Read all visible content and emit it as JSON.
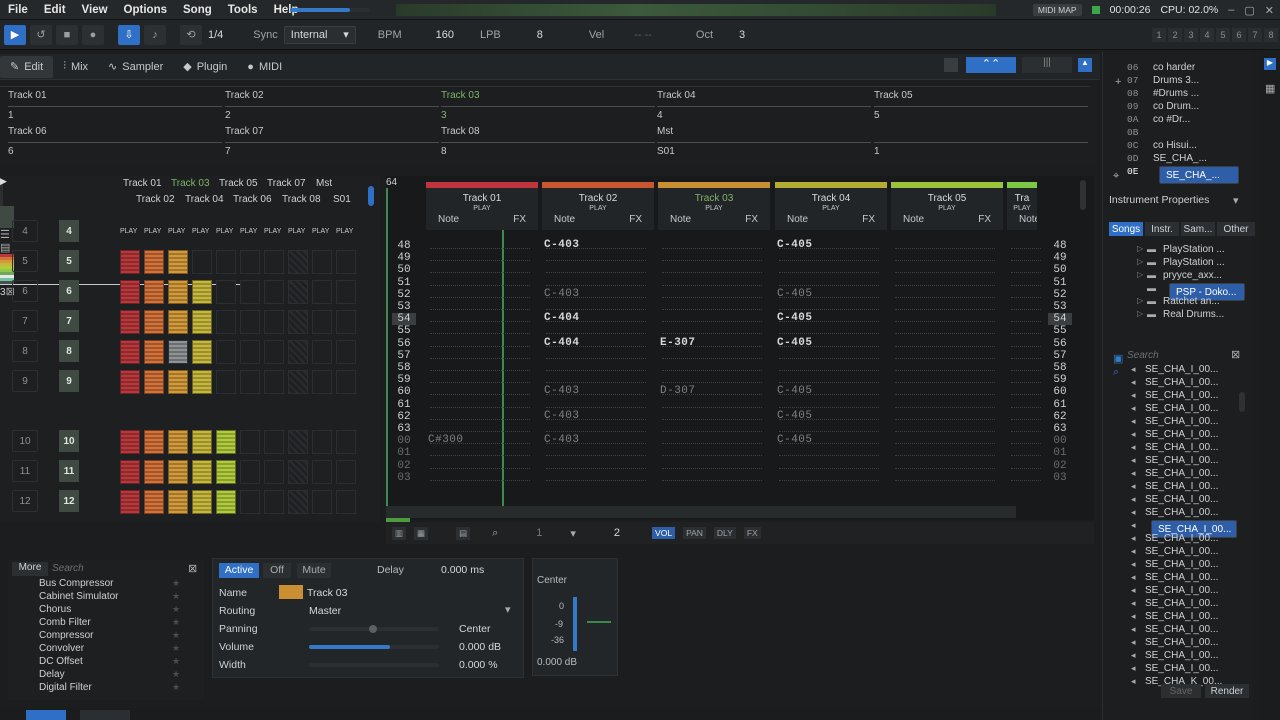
{
  "menu": [
    "File",
    "Edit",
    "View",
    "Options",
    "Song",
    "Tools",
    "Help"
  ],
  "status": {
    "midi_map": "MIDI MAP",
    "time": "00:00:26",
    "cpu": "CPU: 02.0%"
  },
  "transport": {
    "pattern_pos": "1/4",
    "sync_label": "Sync",
    "sync_value": "Internal",
    "bpm_label": "BPM",
    "bpm": "160",
    "lpb_label": "LPB",
    "lpb": "8",
    "vel_label": "Vel",
    "vel_value": "-- --",
    "oct_label": "Oct",
    "oct": "3",
    "oct_buttons": [
      "1",
      "2",
      "3",
      "4",
      "5",
      "6",
      "7",
      "8"
    ]
  },
  "tabs": [
    "Edit",
    "Mix",
    "Sampler",
    "Plugin",
    "MIDI"
  ],
  "scopes": [
    {
      "name": "Track 01",
      "num": "1",
      "active": false
    },
    {
      "name": "Track 02",
      "num": "2",
      "active": false
    },
    {
      "name": "Track 03",
      "num": "3",
      "active": true
    },
    {
      "name": "Track 04",
      "num": "4",
      "active": false
    },
    {
      "name": "Track 05",
      "num": "5",
      "active": false
    },
    {
      "name": "Track 06",
      "num": "6",
      "active": false
    },
    {
      "name": "Track 07",
      "num": "7",
      "active": false
    },
    {
      "name": "Track 08",
      "num": "8",
      "active": false
    },
    {
      "name": "Mst",
      "num": "S01",
      "active": false
    },
    {
      "name": "",
      "num": "1",
      "active": false
    }
  ],
  "matrix": {
    "header_top": [
      "Track 01",
      "Track 03",
      "Track 05",
      "Track 07",
      "Mst"
    ],
    "header_bottom": [
      "Track 02",
      "Track 04",
      "Track 06",
      "Track 08",
      "S01"
    ],
    "play": "PLAY",
    "seq_left": [
      "4",
      "5",
      "6",
      "7",
      "8",
      "9",
      "10",
      "11",
      "12"
    ],
    "seq_right": [
      "4",
      "5",
      "6",
      "7",
      "8",
      "9",
      "10",
      "11",
      "12"
    ],
    "block_label": "3"
  },
  "pattern": {
    "lines": "64",
    "tracks": [
      {
        "name": "Track 01",
        "color": "#c0353d",
        "active": false
      },
      {
        "name": "Track 02",
        "color": "#c9562f",
        "active": false
      },
      {
        "name": "Track 03",
        "color": "#c98f32",
        "active": true
      },
      {
        "name": "Track 04",
        "color": "#b4ad33",
        "active": false
      },
      {
        "name": "Track 05",
        "color": "#9dc33a",
        "active": false
      },
      {
        "name": "Tra",
        "color": "#7dc842",
        "active": false
      }
    ],
    "play": "PLAY",
    "note": "Note",
    "fx": "FX",
    "rows": [
      "48",
      "49",
      "50",
      "51",
      "52",
      "53",
      "54",
      "55",
      "56",
      "57",
      "58",
      "59",
      "60",
      "61",
      "62",
      "63",
      "00",
      "01",
      "02",
      "03"
    ],
    "notes": [
      {
        "row": 0,
        "col": 1,
        "v": "C-403",
        "dim": false
      },
      {
        "row": 0,
        "col": 3,
        "v": "C-405",
        "dim": false
      },
      {
        "row": 4,
        "col": 1,
        "v": "C-403",
        "dim": true
      },
      {
        "row": 4,
        "col": 3,
        "v": "C-405",
        "dim": true
      },
      {
        "row": 6,
        "col": 1,
        "v": "C-404",
        "dim": false
      },
      {
        "row": 6,
        "col": 3,
        "v": "C-405",
        "dim": false
      },
      {
        "row": 8,
        "col": 1,
        "v": "C-404",
        "dim": false
      },
      {
        "row": 8,
        "col": 2,
        "v": "E-307",
        "dim": false
      },
      {
        "row": 8,
        "col": 3,
        "v": "C-405",
        "dim": false
      },
      {
        "row": 12,
        "col": 1,
        "v": "C-403",
        "dim": true
      },
      {
        "row": 12,
        "col": 2,
        "v": "D-307",
        "dim": true
      },
      {
        "row": 12,
        "col": 3,
        "v": "C-405",
        "dim": true
      },
      {
        "row": 14,
        "col": 1,
        "v": "C-403",
        "dim": true
      },
      {
        "row": 14,
        "col": 3,
        "v": "C-405",
        "dim": true
      },
      {
        "row": 16,
        "col": 0,
        "v": "C#300",
        "dim": true
      },
      {
        "row": 16,
        "col": 1,
        "v": "C-403",
        "dim": true
      },
      {
        "row": 16,
        "col": 3,
        "v": "C-405",
        "dim": true
      }
    ]
  },
  "pattern_bar": {
    "v1": "1",
    "v2": "2",
    "toggles": [
      "VOL",
      "PAN",
      "DLY",
      "FX"
    ]
  },
  "dsp": {
    "more": "More",
    "search": "Search",
    "items": [
      "Bus Compressor",
      "Cabinet Simulator",
      "Chorus",
      "Comb Filter",
      "Compressor",
      "Convolver",
      "DC Offset",
      "Delay",
      "Digital Filter"
    ]
  },
  "device": {
    "active": "Active",
    "off": "Off",
    "mute": "Mute",
    "delay_label": "Delay",
    "delay_value": "0.000 ms",
    "name_label": "Name",
    "name_value": "Track 03",
    "routing_label": "Routing",
    "routing_value": "Master",
    "panning_label": "Panning",
    "panning_value": "Center",
    "volume_label": "Volume",
    "volume_value": "0.000 dB",
    "width_label": "Width",
    "width_value": "0.000 %",
    "volume_level": 0.62,
    "panning_level": 0.5,
    "width_level": 0.02
  },
  "meter": {
    "label": "Center",
    "marks": [
      "0",
      "-9",
      "-36"
    ],
    "value": "0.000 dB"
  },
  "instruments": {
    "list": [
      {
        "n": "06",
        "name": "co harder"
      },
      {
        "n": "07",
        "name": "Drums 3..."
      },
      {
        "n": "08",
        "name": "#Drums ..."
      },
      {
        "n": "09",
        "name": "co Drum..."
      },
      {
        "n": "0A",
        "name": "co #Dr..."
      },
      {
        "n": "0B",
        "name": ""
      },
      {
        "n": "0C",
        "name": "co Hisui..."
      },
      {
        "n": "0D",
        "name": "SE_CHA_..."
      },
      {
        "n": "0E",
        "name": "SE_CHA_..."
      }
    ],
    "title": "Instrument Properties",
    "tabs": [
      "Songs",
      "Instr.",
      "Sam...",
      "Other"
    ],
    "tree": [
      "PlayStation ...",
      "PlayStation ...",
      "pryyce_axx...",
      "PSP - Doko...",
      "Ratchet an...",
      "Real Drums..."
    ],
    "search": "Search",
    "samples": [
      "SE_CHA_I_00...",
      "SE_CHA_I_00...",
      "SE_CHA_I_00...",
      "SE_CHA_I_00...",
      "SE_CHA_I_00...",
      "SE_CHA_I_00...",
      "SE_CHA_I_00...",
      "SE_CHA_I_00...",
      "SE_CHA_I_00...",
      "SE_CHA_I_00...",
      "SE_CHA_I_00...",
      "SE_CHA_I_00...",
      "SE_CHA_I_00...",
      "SE_CHA_I_00...",
      "SE_CHA_I_00...",
      "SE_CHA_I_00...",
      "SE_CHA_I_00...",
      "SE_CHA_I_00...",
      "SE_CHA_I_00...",
      "SE_CHA_I_00...",
      "SE_CHA_I_00...",
      "SE_CHA_I_00...",
      "SE_CHA_I_00...",
      "SE_CHA_I_00...",
      "SE_CHA_K_00..."
    ],
    "save": "Save",
    "render": "Render"
  }
}
